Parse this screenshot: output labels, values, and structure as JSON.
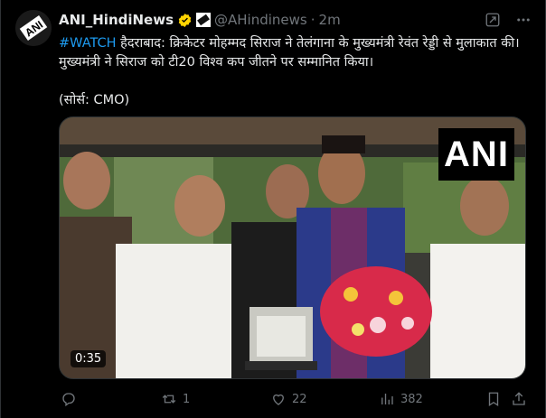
{
  "tweet": {
    "author_name": "ANI_HindiNews",
    "handle": "@AHindinews",
    "separator": "·",
    "time": "2m",
    "hashtag": "#WATCH",
    "body_text": " हैदराबाद: क्रिकेटर मोहम्मद सिराज ने तेलंगाना के मुख्यमंत्री रेवंत रेड्डी से मुलाकात की। मुख्यमंत्री ने सिराज को टी20 विश्व कप जीतने पर सम्मानित किया।",
    "source_text": "(सोर्स: CMO)",
    "avatar_text": "ANI"
  },
  "media": {
    "watermark": "ANI",
    "duration": "0:35"
  },
  "actions": {
    "reply_count": "",
    "retweet_count": "1",
    "like_count": "22",
    "view_count": "382"
  },
  "icons": {
    "verified": "verified-badge-icon",
    "affiliation": "affiliation-badge-icon",
    "grok": "grok-icon",
    "more": "more-icon",
    "reply": "reply-icon",
    "retweet": "retweet-icon",
    "like": "heart-icon",
    "views": "views-icon",
    "bookmark": "bookmark-icon",
    "share": "share-icon"
  },
  "colors": {
    "background": "#000000",
    "text": "#e7e9ea",
    "muted": "#71767b",
    "link": "#1d9bf0",
    "verified": "#ffd400"
  }
}
